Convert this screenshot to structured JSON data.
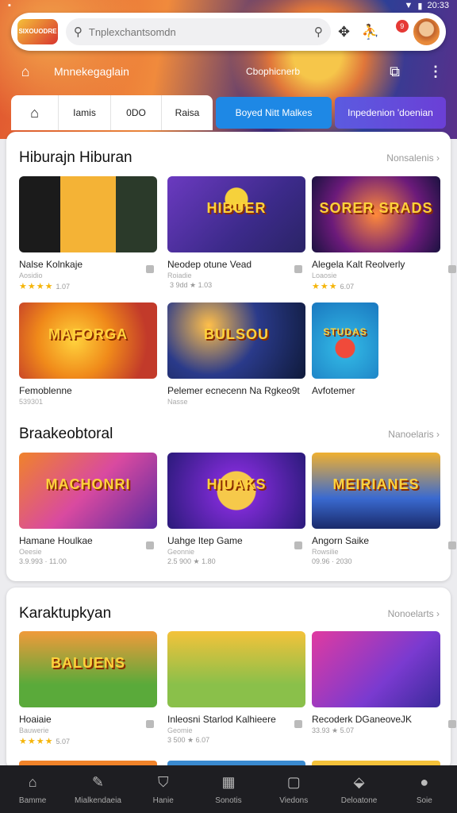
{
  "status_bar": {
    "time": "20:33"
  },
  "header": {
    "logo_text": "SIXOUODRE",
    "search_placeholder": "Tnplexchantsomdn",
    "notification_count": "9"
  },
  "sub_bar": {
    "title": "Mnnekegaglain",
    "center": "Cbophicnerb"
  },
  "tabs": {
    "items": [
      "Iamis",
      "0DO",
      "Raisa"
    ],
    "pill_blue": "Boyed Nitt Malkes",
    "pill_purple": "Inpedenion 'doenian"
  },
  "sections": [
    {
      "title": "Hiburajn Hiburan",
      "more": "Nonsalenis",
      "rows": [
        [
          {
            "title": "Nalse Kolnkaje",
            "sub": "Aosidio",
            "meta": "1.07",
            "stars": "★★★★",
            "art": ""
          },
          {
            "title": "Neodep otune Vead",
            "sub": "Roiadie",
            "meta": "3 9dd ★ 1.03",
            "stars": "",
            "art": "HIBUER"
          },
          {
            "title": "Alegela Kalt Reolverly",
            "sub": "Loaosie",
            "meta": "6.07",
            "stars": "★★★",
            "art": "SORER SRADS"
          }
        ],
        [
          {
            "title": "Femoblenne",
            "sub": "539301",
            "meta": "",
            "stars": "",
            "art": "MAFORGA"
          },
          {
            "title": "Pelemer ecnecenn Na Rgkeo9t",
            "sub": "Nasse",
            "meta": "",
            "stars": "",
            "art": "BULSOU"
          },
          {
            "title": "Avfotemer",
            "sub": "",
            "meta": "",
            "stars": "",
            "art": "STUDAS"
          }
        ]
      ]
    },
    {
      "title": "Braakeobtoral",
      "more": "Nanoelaris",
      "rows": [
        [
          {
            "title": "Hamane Houlkae",
            "sub": "Oeesie",
            "meta": "3.9.993 · 11.00",
            "stars": "",
            "art": "MACHONRI"
          },
          {
            "title": "Uahge Itep Game",
            "sub": "Geonnie",
            "meta": "2.5 900 ★ 1.80",
            "stars": "",
            "art": "HIUAKS"
          },
          {
            "title": "Angorn Saike",
            "sub": "Rowsilie",
            "meta": "09.96 · 2030",
            "stars": "",
            "art": "MEIRIANES"
          }
        ]
      ]
    },
    {
      "title": "Karaktupkyan",
      "more": "Nonoelarts",
      "rows": [
        [
          {
            "title": "Hoaiaie",
            "sub": "Bauwerie",
            "meta": "5.07",
            "stars": "★★★★",
            "art": "BALUENS"
          },
          {
            "title": "Inleosni Starlod Kalhieere",
            "sub": "Geomie",
            "meta": "3 500 ★ 6.07",
            "stars": "",
            "art": ""
          },
          {
            "title": "Recoderk DGaneoveJK",
            "sub": "",
            "meta": "33.93 ★ 5.07",
            "stars": "",
            "art": ""
          }
        ]
      ]
    }
  ],
  "bottom_nav": [
    "Bamme",
    "Mialkendaeia",
    "Hanie",
    "Sonotis",
    "Viedons",
    "Deloatone",
    "Soie"
  ]
}
